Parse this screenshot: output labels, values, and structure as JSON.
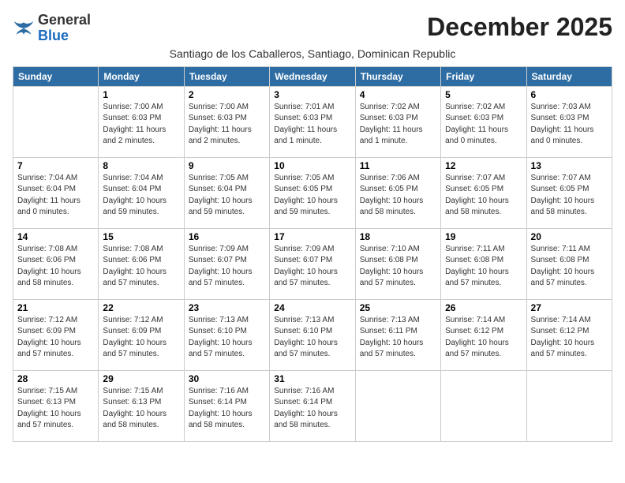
{
  "logo": {
    "general": "General",
    "blue": "Blue"
  },
  "title": "December 2025",
  "subtitle": "Santiago de los Caballeros, Santiago, Dominican Republic",
  "weekdays": [
    "Sunday",
    "Monday",
    "Tuesday",
    "Wednesday",
    "Thursday",
    "Friday",
    "Saturday"
  ],
  "weeks": [
    [
      {
        "day": "",
        "info": ""
      },
      {
        "day": "1",
        "info": "Sunrise: 7:00 AM\nSunset: 6:03 PM\nDaylight: 11 hours\nand 2 minutes."
      },
      {
        "day": "2",
        "info": "Sunrise: 7:00 AM\nSunset: 6:03 PM\nDaylight: 11 hours\nand 2 minutes."
      },
      {
        "day": "3",
        "info": "Sunrise: 7:01 AM\nSunset: 6:03 PM\nDaylight: 11 hours\nand 1 minute."
      },
      {
        "day": "4",
        "info": "Sunrise: 7:02 AM\nSunset: 6:03 PM\nDaylight: 11 hours\nand 1 minute."
      },
      {
        "day": "5",
        "info": "Sunrise: 7:02 AM\nSunset: 6:03 PM\nDaylight: 11 hours\nand 0 minutes."
      },
      {
        "day": "6",
        "info": "Sunrise: 7:03 AM\nSunset: 6:03 PM\nDaylight: 11 hours\nand 0 minutes."
      }
    ],
    [
      {
        "day": "7",
        "info": "Sunrise: 7:04 AM\nSunset: 6:04 PM\nDaylight: 11 hours\nand 0 minutes."
      },
      {
        "day": "8",
        "info": "Sunrise: 7:04 AM\nSunset: 6:04 PM\nDaylight: 10 hours\nand 59 minutes."
      },
      {
        "day": "9",
        "info": "Sunrise: 7:05 AM\nSunset: 6:04 PM\nDaylight: 10 hours\nand 59 minutes."
      },
      {
        "day": "10",
        "info": "Sunrise: 7:05 AM\nSunset: 6:05 PM\nDaylight: 10 hours\nand 59 minutes."
      },
      {
        "day": "11",
        "info": "Sunrise: 7:06 AM\nSunset: 6:05 PM\nDaylight: 10 hours\nand 58 minutes."
      },
      {
        "day": "12",
        "info": "Sunrise: 7:07 AM\nSunset: 6:05 PM\nDaylight: 10 hours\nand 58 minutes."
      },
      {
        "day": "13",
        "info": "Sunrise: 7:07 AM\nSunset: 6:05 PM\nDaylight: 10 hours\nand 58 minutes."
      }
    ],
    [
      {
        "day": "14",
        "info": "Sunrise: 7:08 AM\nSunset: 6:06 PM\nDaylight: 10 hours\nand 58 minutes."
      },
      {
        "day": "15",
        "info": "Sunrise: 7:08 AM\nSunset: 6:06 PM\nDaylight: 10 hours\nand 57 minutes."
      },
      {
        "day": "16",
        "info": "Sunrise: 7:09 AM\nSunset: 6:07 PM\nDaylight: 10 hours\nand 57 minutes."
      },
      {
        "day": "17",
        "info": "Sunrise: 7:09 AM\nSunset: 6:07 PM\nDaylight: 10 hours\nand 57 minutes."
      },
      {
        "day": "18",
        "info": "Sunrise: 7:10 AM\nSunset: 6:08 PM\nDaylight: 10 hours\nand 57 minutes."
      },
      {
        "day": "19",
        "info": "Sunrise: 7:11 AM\nSunset: 6:08 PM\nDaylight: 10 hours\nand 57 minutes."
      },
      {
        "day": "20",
        "info": "Sunrise: 7:11 AM\nSunset: 6:08 PM\nDaylight: 10 hours\nand 57 minutes."
      }
    ],
    [
      {
        "day": "21",
        "info": "Sunrise: 7:12 AM\nSunset: 6:09 PM\nDaylight: 10 hours\nand 57 minutes."
      },
      {
        "day": "22",
        "info": "Sunrise: 7:12 AM\nSunset: 6:09 PM\nDaylight: 10 hours\nand 57 minutes."
      },
      {
        "day": "23",
        "info": "Sunrise: 7:13 AM\nSunset: 6:10 PM\nDaylight: 10 hours\nand 57 minutes."
      },
      {
        "day": "24",
        "info": "Sunrise: 7:13 AM\nSunset: 6:10 PM\nDaylight: 10 hours\nand 57 minutes."
      },
      {
        "day": "25",
        "info": "Sunrise: 7:13 AM\nSunset: 6:11 PM\nDaylight: 10 hours\nand 57 minutes."
      },
      {
        "day": "26",
        "info": "Sunrise: 7:14 AM\nSunset: 6:12 PM\nDaylight: 10 hours\nand 57 minutes."
      },
      {
        "day": "27",
        "info": "Sunrise: 7:14 AM\nSunset: 6:12 PM\nDaylight: 10 hours\nand 57 minutes."
      }
    ],
    [
      {
        "day": "28",
        "info": "Sunrise: 7:15 AM\nSunset: 6:13 PM\nDaylight: 10 hours\nand 57 minutes."
      },
      {
        "day": "29",
        "info": "Sunrise: 7:15 AM\nSunset: 6:13 PM\nDaylight: 10 hours\nand 58 minutes."
      },
      {
        "day": "30",
        "info": "Sunrise: 7:16 AM\nSunset: 6:14 PM\nDaylight: 10 hours\nand 58 minutes."
      },
      {
        "day": "31",
        "info": "Sunrise: 7:16 AM\nSunset: 6:14 PM\nDaylight: 10 hours\nand 58 minutes."
      },
      {
        "day": "",
        "info": ""
      },
      {
        "day": "",
        "info": ""
      },
      {
        "day": "",
        "info": ""
      }
    ]
  ]
}
